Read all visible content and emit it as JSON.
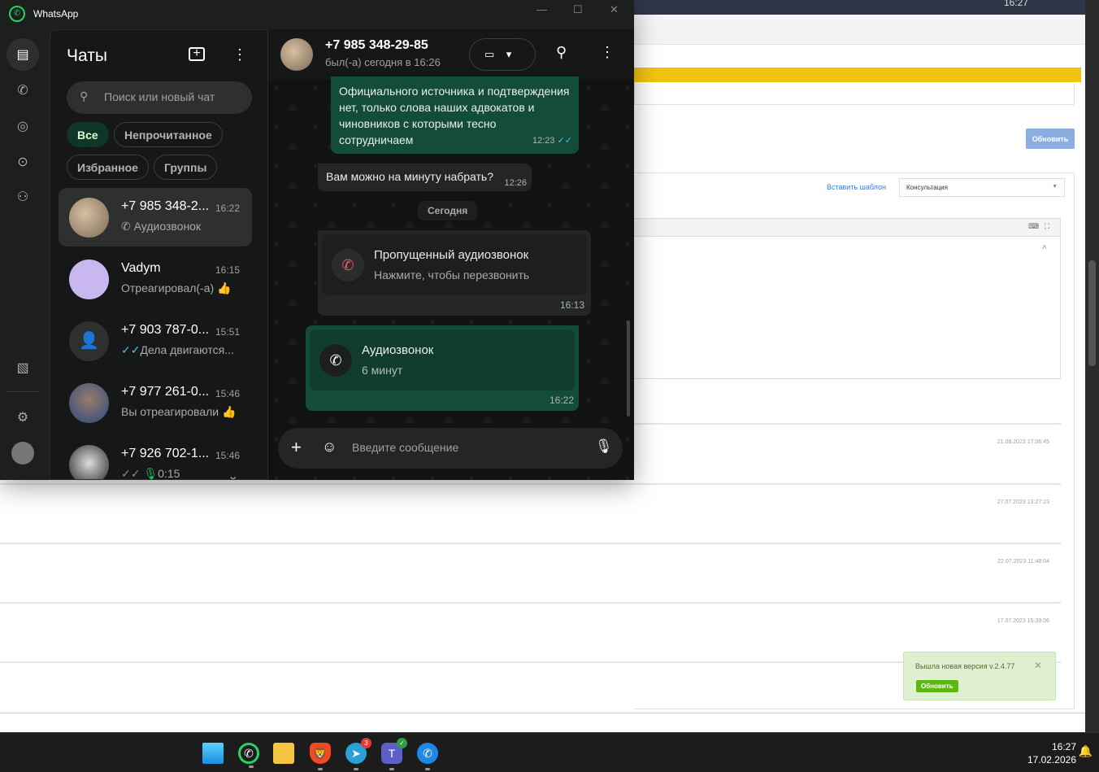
{
  "whatsapp": {
    "title": "WhatsApp",
    "rail": [
      "chats-icon",
      "calls-icon",
      "status-icon",
      "channels-icon",
      "communities-icon",
      "media-icon",
      "settings-icon",
      "profile-avatar"
    ],
    "list": {
      "title": "Чаты",
      "search_placeholder": "Поиск или новый чат",
      "filters": [
        "Все",
        "Непрочитанное",
        "Избранное",
        "Группы"
      ],
      "chats": [
        {
          "name": "+7 985 348-2...",
          "time": "16:22",
          "preview": "Аудиозвонок",
          "icon": "call-icon",
          "selected": true
        },
        {
          "name": "Vadym",
          "time": "16:15",
          "preview": "Отреагировал(-а) 👍"
        },
        {
          "name": "+7 903 787-0...",
          "time": "15:51",
          "preview": "Дела двигаются...",
          "icon": "double-check-icon"
        },
        {
          "name": "+7 977 261-0...",
          "time": "15:46",
          "preview": "Вы отреагировали 👍"
        },
        {
          "name": "+7 926 702-1...",
          "time": "15:46",
          "preview": "0:15",
          "icon": "mic-icon"
        }
      ]
    },
    "chat": {
      "contact": "+7 985 348-29-85",
      "status": "был(-а) сегодня в 16:26",
      "messages": [
        {
          "dir": "out",
          "text": "Официального источника и подтверждения нет, только слова наших адвокатов и чиновников с которыми тесно сотрудничаем",
          "time": "12:23"
        },
        {
          "dir": "in",
          "text": "Вам можно на минуту набрать?",
          "time": "12:26"
        }
      ],
      "date_divider": "Сегодня",
      "missed_call": {
        "title": "Пропущенный аудиозвонок",
        "subtitle": "Нажмите, чтобы перезвонить",
        "time": "16:13"
      },
      "call": {
        "title": "Аудиозвонок",
        "subtitle": "6 минут",
        "time": "16:22"
      },
      "composer_placeholder": "Введите сообщение"
    }
  },
  "webpage": {
    "update_button": "Обновить",
    "insert_template": "Вставить шаблон",
    "template_select": "Консультация",
    "dates": [
      "21.08.2023 17:06:45",
      "27.07.2023 13:27:23",
      "22.07.2023 11:48:04",
      "17.07.2023 15:39:06"
    ],
    "notification": {
      "text": "Вышла новая версия v.2.4.77",
      "button": "Обновить"
    },
    "topbar_time": "16:27"
  },
  "taskbar": {
    "apps": [
      "windows-start",
      "whatsapp",
      "file-explorer",
      "brave",
      "telegram",
      "teams",
      "phone"
    ],
    "telegram_badge": "3",
    "time": "16:27",
    "date": "17.02.2026"
  },
  "colors": {
    "accent": "#21c063",
    "outgoing": "#144d37",
    "missed": "#f15c6d",
    "yellow": "#f1c40f"
  }
}
